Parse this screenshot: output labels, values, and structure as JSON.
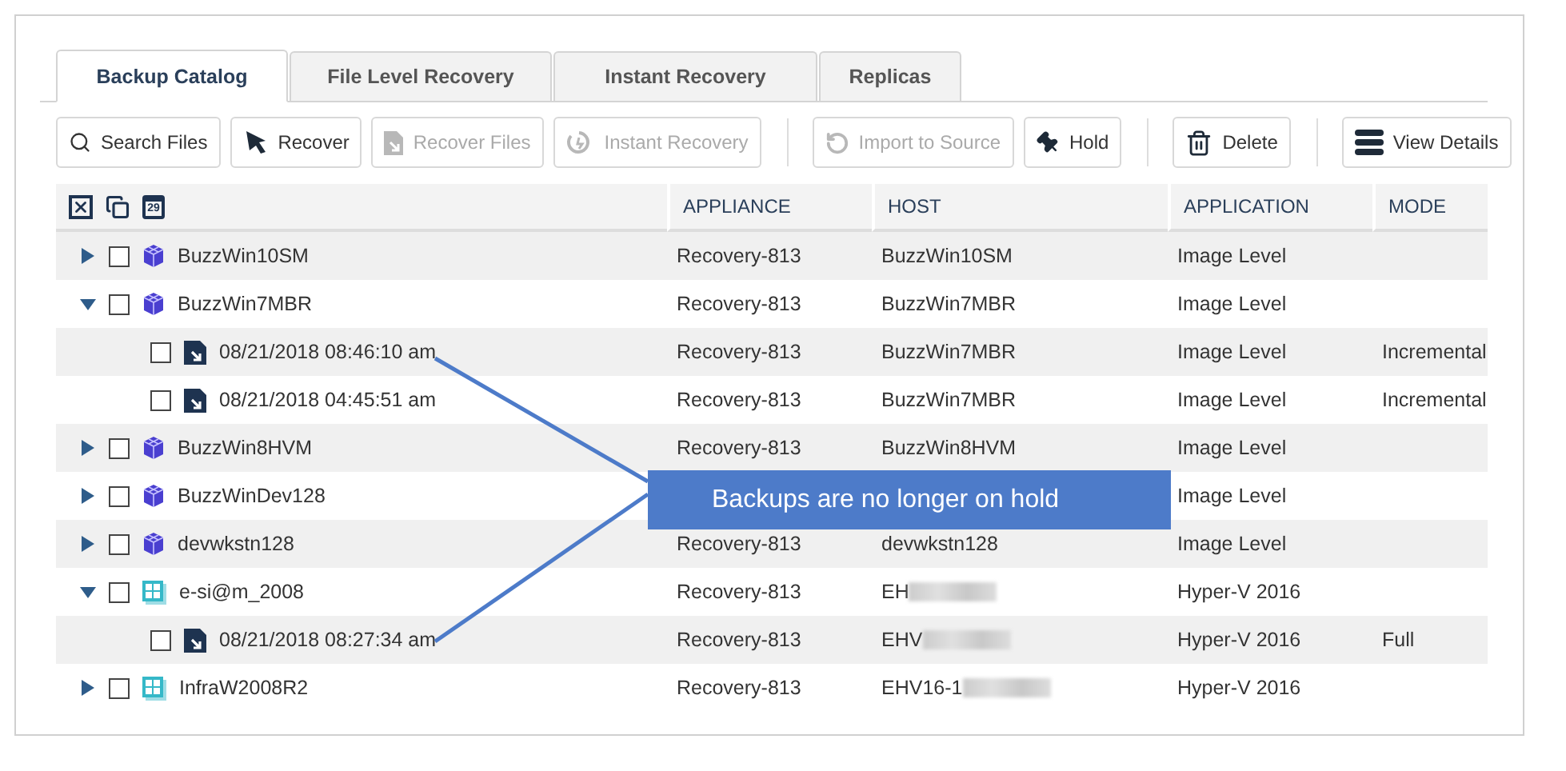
{
  "tabs": [
    {
      "label": "Backup Catalog",
      "selected": true
    },
    {
      "label": "File Level Recovery",
      "selected": false
    },
    {
      "label": "Instant Recovery",
      "selected": false
    },
    {
      "label": "Replicas",
      "selected": false
    }
  ],
  "toolbar": [
    {
      "label": "Search Files",
      "disabled": false,
      "separator_before": false
    },
    {
      "label": "Recover",
      "disabled": false,
      "separator_before": false
    },
    {
      "label": "Recover Files",
      "disabled": true,
      "separator_before": false
    },
    {
      "label": "Instant Recovery",
      "disabled": true,
      "separator_before": false
    },
    {
      "label": "Import to Source",
      "disabled": true,
      "separator_before": true
    },
    {
      "label": "Hold",
      "disabled": false,
      "separator_before": false
    },
    {
      "label": "Delete",
      "disabled": false,
      "separator_before": true
    },
    {
      "label": "View Details",
      "disabled": false,
      "separator_before": true
    }
  ],
  "table": {
    "calendar_day": "29",
    "columns": [
      "APPLIANCE",
      "HOST",
      "APPLICATION",
      "MODE"
    ],
    "rows": [
      {
        "name": "BuzzWin10SM",
        "kind": "vm",
        "expanded": false,
        "checked": false,
        "appliance": "Recovery-813",
        "host": "BuzzWin10SM",
        "application": "Image Level"
      },
      {
        "name": "BuzzWin7MBR",
        "kind": "vm",
        "expanded": true,
        "checked": false,
        "appliance": "Recovery-813",
        "host": "BuzzWin7MBR",
        "application": "Image Level",
        "children": [
          {
            "name": "08/21/2018 08:46:10 am",
            "kind": "backup",
            "checked": false,
            "appliance": "Recovery-813",
            "host": "BuzzWin7MBR",
            "application": "Image Level",
            "mode": "Incremental"
          },
          {
            "name": "08/21/2018 04:45:51 am",
            "kind": "backup",
            "checked": false,
            "appliance": "Recovery-813",
            "host": "BuzzWin7MBR",
            "application": "Image Level",
            "mode": "Incremental"
          }
        ]
      },
      {
        "name": "BuzzWin8HVM",
        "kind": "vm",
        "expanded": false,
        "checked": false,
        "appliance": "Recovery-813",
        "host": "BuzzWin8HVM",
        "application": "Image Level"
      },
      {
        "name": "BuzzWinDev128",
        "kind": "vm",
        "expanded": false,
        "checked": false,
        "application": "Image Level"
      },
      {
        "name": "devwkstn128",
        "kind": "vm",
        "expanded": false,
        "checked": false,
        "appliance": "Recovery-813",
        "host": "devwkstn128",
        "application": "Image Level"
      },
      {
        "name": "e-si@m_2008",
        "kind": "hyperv",
        "expanded": true,
        "checked": false,
        "appliance": "Recovery-813",
        "host": "EH",
        "host_redacted": true,
        "application": "Hyper-V 2016",
        "children": [
          {
            "name": "08/21/2018 08:27:34 am",
            "kind": "backup",
            "checked": false,
            "appliance": "Recovery-813",
            "host": "EHV",
            "host_redacted": true,
            "application": "Hyper-V 2016",
            "mode": "Full"
          }
        ]
      },
      {
        "name": "InfraW2008R2",
        "kind": "hyperv",
        "expanded": false,
        "checked": false,
        "appliance": "Recovery-813",
        "host": "EHV16-1",
        "host_redacted": true,
        "application": "Hyper-V 2016"
      }
    ]
  },
  "callout": {
    "text": "Backups are no longer on hold"
  }
}
